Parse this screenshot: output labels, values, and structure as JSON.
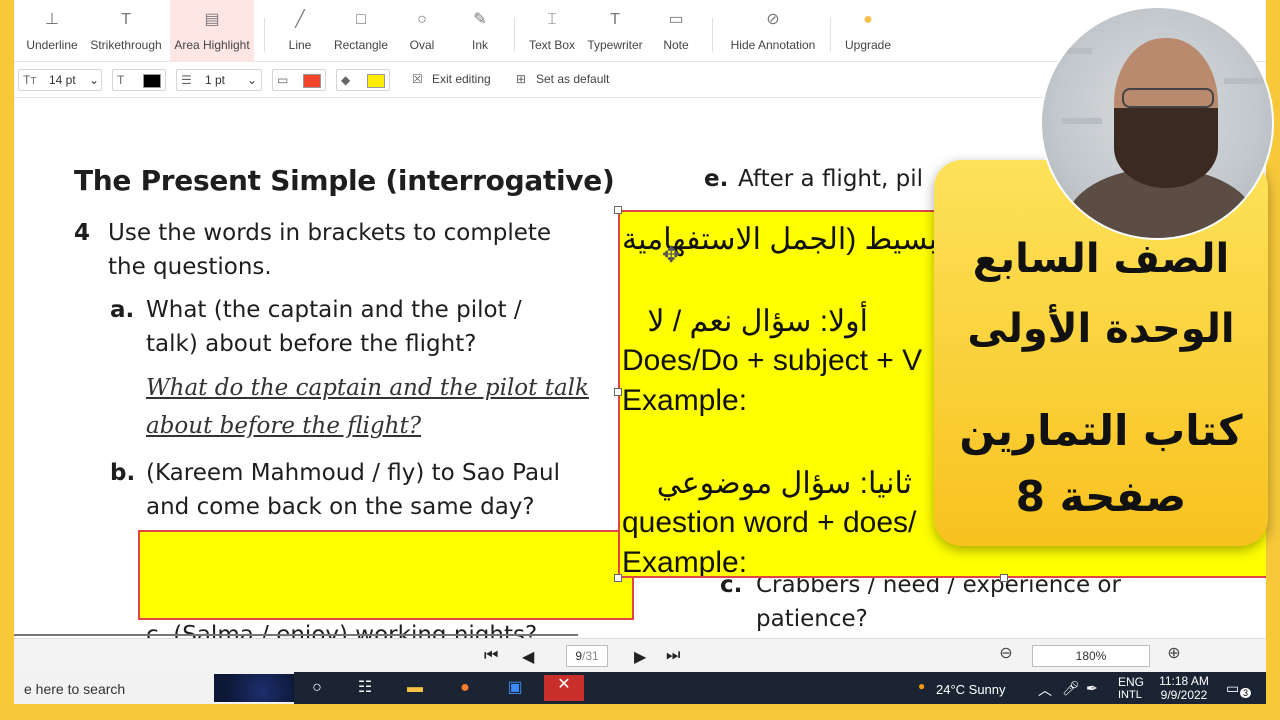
{
  "ribbon": {
    "tools": [
      {
        "label": "Underline",
        "icon": "underline-icon"
      },
      {
        "label": "Strikethrough",
        "icon": "strikethrough-icon"
      },
      {
        "label": "Area Highlight",
        "icon": "area-highlight-icon"
      },
      {
        "label": "Line",
        "icon": "line-icon"
      },
      {
        "label": "Rectangle",
        "icon": "rectangle-icon"
      },
      {
        "label": "Oval",
        "icon": "oval-icon"
      },
      {
        "label": "Ink",
        "icon": "ink-icon"
      },
      {
        "label": "Text Box",
        "icon": "text-box-icon"
      },
      {
        "label": "Typewriter",
        "icon": "typewriter-icon"
      },
      {
        "label": "Note",
        "icon": "note-icon"
      },
      {
        "label": "Hide Annotation",
        "icon": "hide-annotation-icon"
      },
      {
        "label": "Upgrade",
        "icon": "upgrade-icon"
      }
    ]
  },
  "props": {
    "font_size": "14 pt",
    "line_width": "1 pt",
    "exit_editing": "Exit editing",
    "set_default": "Set as default",
    "text_color": "#000000",
    "border_color": "#f0442c",
    "fill_color": "#ffee00"
  },
  "doc": {
    "heading": "The Present Simple (interrogative)",
    "ex_number": "4",
    "instruction_1": "Use the words in brackets to complete",
    "instruction_2": "the questions.",
    "a_label": "a.",
    "a_q1": "What (the captain and the pilot /",
    "a_q2": "talk) about before the flight?",
    "a_ans1": "What do the captain and the pilot talk",
    "a_ans2": "about before the flight?",
    "b_label": "b.",
    "b_q1": "(Kareem Mahmoud / fly) to Sao Paul",
    "b_q2": "and come back on the same day?",
    "c_left": "c.  (Salma / enjoy) working nights?",
    "e_label": "e.",
    "e_text": "After a flight, pil",
    "c_right_label": "c.",
    "c_right_1": "Crabbers / need / experience or",
    "c_right_2": "patience?"
  },
  "sticky": {
    "line1": "المضارع البسيط (الجمل الاستفهامية",
    "line2": "أولا: سؤال نعم / لا",
    "line3": "Does/Do + subject + V",
    "line4": "Example:",
    "line5": "ثانيا: سؤال موضوعي",
    "line6": "question word + does/",
    "line7": "Example:"
  },
  "card": {
    "line1": "الصف السابع",
    "line2": "الوحدة الأولى",
    "line3": "كتاب التمارين",
    "line4": "صفحة 8"
  },
  "nav": {
    "current_page": "9",
    "total_pages": "/31",
    "zoom": "180%"
  },
  "taskbar": {
    "search_placeholder": "e here to search",
    "weather": "24°C  Sunny",
    "lang1": "ENG",
    "lang2": "INTL",
    "time": "11:18 AM",
    "date": "9/9/2022",
    "notif_count": "3"
  }
}
